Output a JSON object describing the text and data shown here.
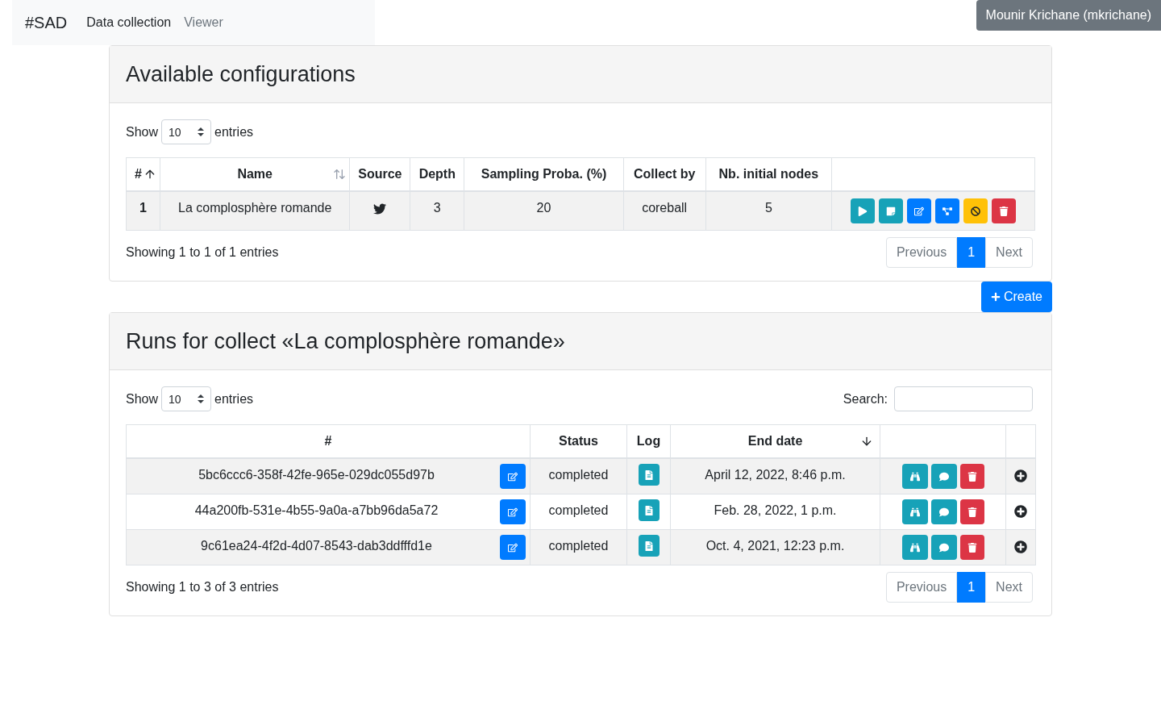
{
  "navbar": {
    "brand": "#SAD",
    "links": [
      {
        "label": "Data collection",
        "selected": true
      },
      {
        "label": "Viewer",
        "selected": false
      }
    ],
    "user": "Mounir Krichane (mkrichane)"
  },
  "configurations": {
    "title": "Available configurations",
    "length": {
      "before": "Show",
      "value": "10",
      "after": "entries"
    },
    "columns": [
      {
        "label": "#",
        "kind": "asc"
      },
      {
        "label": "Name",
        "kind": "both"
      },
      {
        "label": "Source",
        "kind": "plain"
      },
      {
        "label": "Depth",
        "kind": "plain"
      },
      {
        "label": "Sampling Proba. (%)",
        "kind": "plain"
      },
      {
        "label": "Collect by",
        "kind": "plain"
      },
      {
        "label": "Nb. initial nodes",
        "kind": "plain"
      }
    ],
    "rows": [
      {
        "index": "1",
        "name": "La complosphère romande",
        "depth": "3",
        "proba": "20",
        "collector": "coreball",
        "nodes": "5",
        "actions": [
          {
            "kind": "run"
          },
          {
            "kind": "notes"
          },
          {
            "kind": "edit"
          },
          {
            "kind": "graph"
          },
          {
            "kind": "disable"
          },
          {
            "kind": "delete"
          }
        ]
      }
    ],
    "info": "Showing 1 to 1 of 1 entries",
    "pagination": [
      {
        "label": "Previous",
        "selected": false
      },
      {
        "label": "1",
        "selected": true
      },
      {
        "label": "Next",
        "selected": false
      }
    ]
  },
  "create_button": "Create",
  "runs": {
    "title": "Runs for collect «La complosphère romande»",
    "length": {
      "before": "Show",
      "value": "10",
      "after": "entries"
    },
    "search": {
      "label": "Search:"
    },
    "columns": [
      {
        "label": "#",
        "kind": "plain"
      },
      {
        "label": "Status",
        "kind": "plain"
      },
      {
        "label": "Log",
        "kind": "plain"
      },
      {
        "label": "End date",
        "kind": "desc"
      }
    ],
    "rows": [
      {
        "id": "5bc6ccc6-358f-42fe-965e-029dc055d97b",
        "status": "completed",
        "end_date": "April 12, 2022, 8:46 p.m."
      },
      {
        "id": "44a200fb-531e-4b55-9a0a-a7bb96da5a72",
        "status": "completed",
        "end_date": "Feb. 28, 2022, 1 p.m."
      },
      {
        "id": "9c61ea24-4f2d-4d07-8543-dab3ddfffd1e",
        "status": "completed",
        "end_date": "Oct. 4, 2021, 12:23 p.m."
      }
    ],
    "info": "Showing 1 to 3 of 3 entries",
    "pagination": [
      {
        "label": "Previous",
        "selected": false
      },
      {
        "label": "1",
        "selected": true
      },
      {
        "label": "Next",
        "selected": false
      }
    ]
  }
}
